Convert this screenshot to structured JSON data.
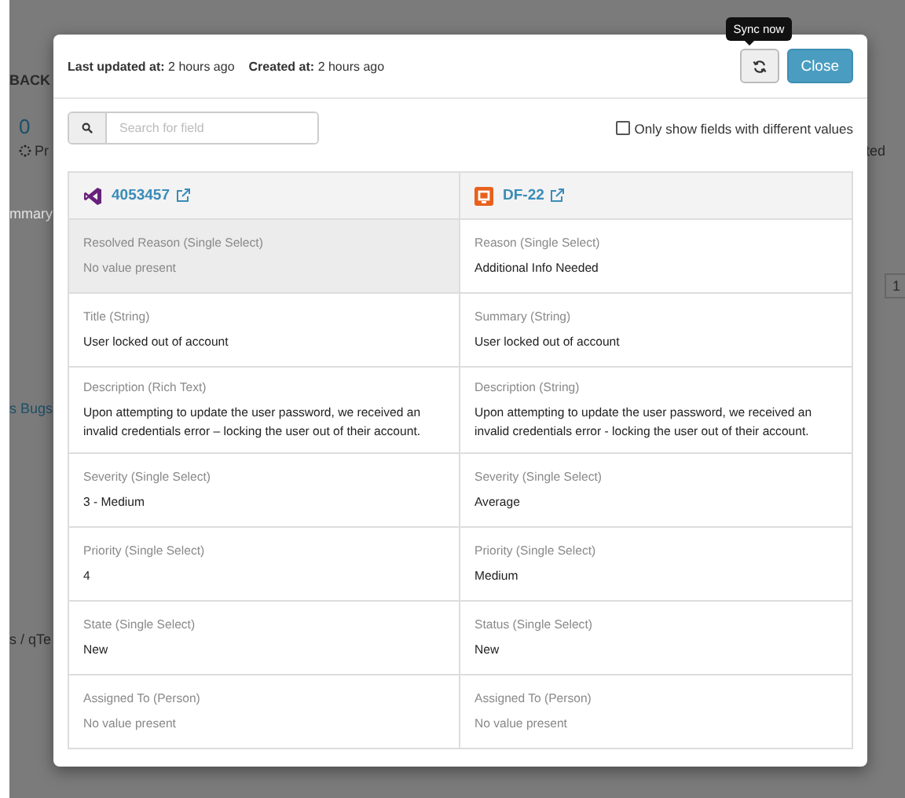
{
  "background": {
    "fragments": [
      {
        "text": "BACK",
        "kind": "heading"
      },
      {
        "text": "0",
        "kind": "link"
      },
      {
        "text": "Pr",
        "kind": "status"
      },
      {
        "text": "ted",
        "kind": "plain"
      },
      {
        "text": "mmary",
        "kind": "faded"
      },
      {
        "text": "1",
        "kind": "pager"
      },
      {
        "text": "s Bugs",
        "kind": "link"
      },
      {
        "text": "s / qTe",
        "kind": "plain"
      }
    ]
  },
  "modal": {
    "meta": [
      {
        "label": "Last updated at:",
        "value": "2 hours ago"
      },
      {
        "label": "Created at:",
        "value": "2 hours ago"
      }
    ],
    "tooltip": "Sync now",
    "close_button": "Close",
    "search": {
      "placeholder": "Search for field"
    },
    "filter": {
      "label": "Only show fields with different values",
      "checked": false
    },
    "columns": [
      {
        "title": "4053457",
        "kind": "vs"
      },
      {
        "title": "DF-22",
        "kind": "df"
      }
    ],
    "rows": [
      {
        "cells": [
          {
            "field": "Resolved Reason (Single Select)",
            "value": "No value present",
            "empty": true,
            "highlighted": true
          },
          {
            "field": "Reason (Single Select)",
            "value": "Additional Info Needed",
            "empty": false,
            "highlighted": false
          }
        ]
      },
      {
        "cells": [
          {
            "field": "Title (String)",
            "value": "User locked out of account",
            "empty": false,
            "highlighted": false
          },
          {
            "field": "Summary (String)",
            "value": "User locked out of account",
            "empty": false,
            "highlighted": false
          }
        ]
      },
      {
        "cells": [
          {
            "field": "Description (Rich Text)",
            "value": "Upon attempting to update the user password, we received an invalid credentials error – locking the user out of their account.",
            "empty": false,
            "highlighted": false
          },
          {
            "field": "Description (String)",
            "value": "Upon attempting to update the user password, we received an invalid credentials error - locking the user out of their account.",
            "empty": false,
            "highlighted": false
          }
        ]
      },
      {
        "cells": [
          {
            "field": "Severity (Single Select)",
            "value": "3 - Medium",
            "empty": false,
            "highlighted": false
          },
          {
            "field": "Severity (Single Select)",
            "value": "Average",
            "empty": false,
            "highlighted": false
          }
        ]
      },
      {
        "cells": [
          {
            "field": "Priority (Single Select)",
            "value": "4",
            "empty": false,
            "highlighted": false
          },
          {
            "field": "Priority (Single Select)",
            "value": "Medium",
            "empty": false,
            "highlighted": false
          }
        ]
      },
      {
        "cells": [
          {
            "field": "State (Single Select)",
            "value": "New",
            "empty": false,
            "highlighted": false
          },
          {
            "field": "Status (Single Select)",
            "value": "New",
            "empty": false,
            "highlighted": false
          }
        ]
      },
      {
        "cells": [
          {
            "field": "Assigned To (Person)",
            "value": "No value present",
            "empty": true,
            "highlighted": false
          },
          {
            "field": "Assigned To (Person)",
            "value": "No value present",
            "empty": true,
            "highlighted": false
          }
        ]
      }
    ]
  }
}
